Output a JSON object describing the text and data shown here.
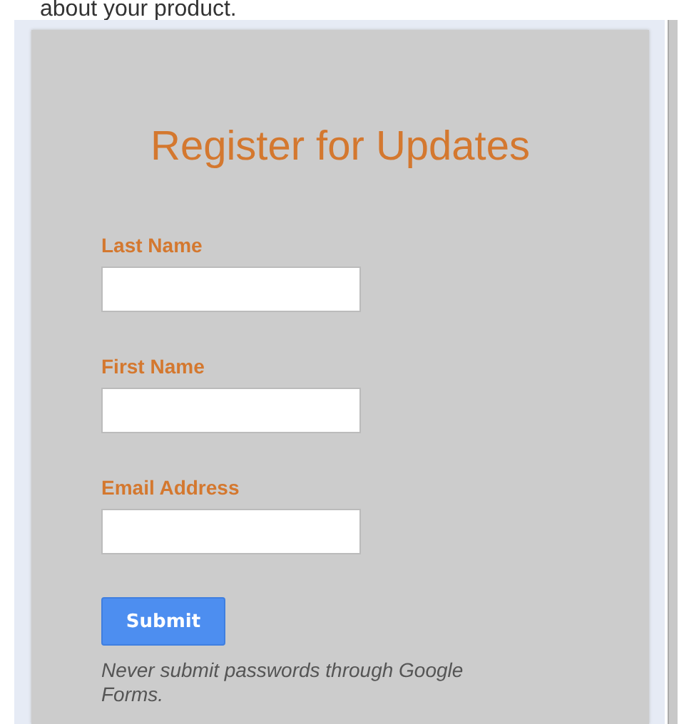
{
  "page_text": "about your product.",
  "form": {
    "title": "Register for Updates",
    "fields": [
      {
        "label": "Last Name"
      },
      {
        "label": "First Name"
      },
      {
        "label": "Email Address"
      }
    ],
    "submit": "Submit",
    "note": "Never submit passwords through Google Forms."
  }
}
